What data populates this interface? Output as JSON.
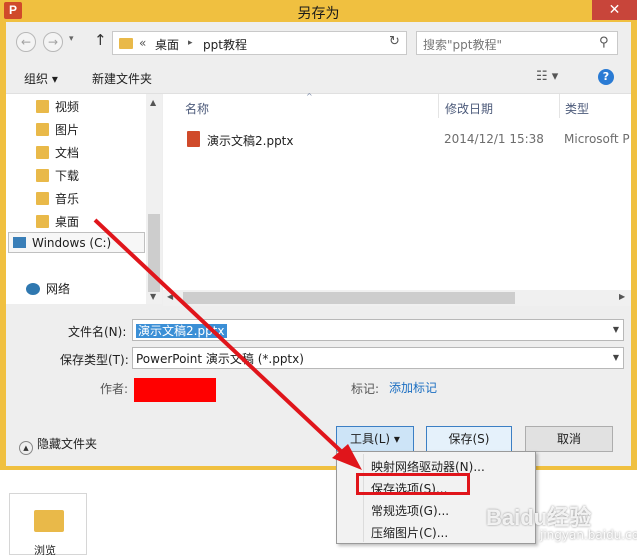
{
  "window": {
    "title": "另存为",
    "app_icon_letter": "P",
    "close_glyph": "✕"
  },
  "nav_bar": {
    "back_glyph": "←",
    "forward_glyph": "→",
    "recent_glyph": "▾",
    "up_glyph": "↑",
    "breadcrumb_prefix": "«",
    "breadcrumb": [
      "桌面",
      "ppt教程"
    ],
    "breadcrumb_separator": "▸",
    "refresh_glyph": "↻",
    "search_placeholder": "搜索\"ppt教程\"",
    "search_glyph": "⚲"
  },
  "toolbar": {
    "organize_label": "组织 ▾",
    "new_folder_label": "新建文件夹",
    "view_glyph": "☷ ▾",
    "help_glyph": "?"
  },
  "sidebar": {
    "items": [
      {
        "label": "视频"
      },
      {
        "label": "图片"
      },
      {
        "label": "文档"
      },
      {
        "label": "下载"
      },
      {
        "label": "音乐"
      },
      {
        "label": "桌面"
      }
    ],
    "drive_label": "Windows (C:)",
    "network_label": "网络"
  },
  "file_list": {
    "columns": [
      "名称",
      "修改日期",
      "类型"
    ],
    "sort_glyph": "^",
    "rows": [
      {
        "name": "演示文稿2.pptx",
        "modified": "2014/12/1 15:38",
        "type": "Microsoft P"
      }
    ]
  },
  "form": {
    "filename_label": "文件名(N):",
    "filename_value": "演示文稿2.pptx",
    "filetype_label": "保存类型(T):",
    "filetype_value": "PowerPoint 演示文稿 (*.pptx)",
    "author_label": "作者:",
    "tags_label": "标记:",
    "tags_link": "添加标记"
  },
  "footer": {
    "hide_folders_label": "隐藏文件夹",
    "tools_label": "工具(L)",
    "tools_caret": "▾",
    "save_label": "保存(S)",
    "cancel_label": "取消"
  },
  "tools_menu": {
    "items": [
      {
        "label": "映射网络驱动器(N)..."
      },
      {
        "label": "保存选项(S)..."
      },
      {
        "label": "常规选项(G)..."
      },
      {
        "label": "压缩图片(C)..."
      }
    ],
    "highlighted_index": 1
  },
  "background": {
    "tile_label": "浏览"
  },
  "watermark": {
    "text": "Baidu经验",
    "sub": "jingyan.baidu.com"
  },
  "colors": {
    "title_bar": "#f0c040",
    "annotation_red": "#e0151b",
    "selection_blue": "#3b8fd6",
    "link_blue": "#1c6fc2"
  }
}
